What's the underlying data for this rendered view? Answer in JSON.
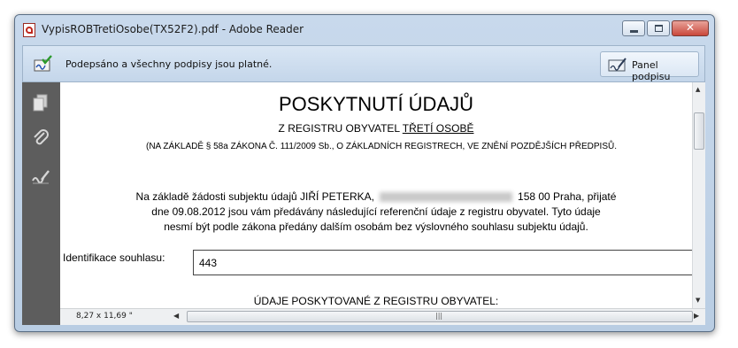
{
  "window": {
    "title": "VypisROBTretiOsobe(TX52F2).pdf - Adobe Reader"
  },
  "signature_bar": {
    "message": "Podepsáno a všechny podpisy jsou platné.",
    "panel_button_label": "Panel podpisu"
  },
  "document": {
    "heading": "POSKYTNUTÍ ÚDAJŮ",
    "subheading_prefix": "Z REGISTRU OBYVATEL ",
    "subheading_underlined": "TŘETÍ OSOBĚ",
    "legal_basis": "(NA ZÁKLADĚ § 58a ZÁKONA Č. 111/2009 Sb., O ZÁKLADNÍCH REGISTRECH, VE ZNĚNÍ POZDĚJŠÍCH PŘEDPISŮ.",
    "para_line1_a": "Na základě žádosti subjektu údajů JIŘÍ PETERKA,",
    "para_line1_b": "158 00 Praha,  přijaté",
    "para_line2": "dne 09.08.2012  jsou vám předávány následující referenční údaje z registru obyvatel. Tyto údaje",
    "para_line3": "nesmí být podle zákona předány dalším osobám bez výslovného souhlasu subjektu údajů.",
    "consent_label": "Identifikace souhlasu:",
    "consent_value": "443",
    "section_title": "ÚDAJE POSKYTOVANÉ Z REGISTRU OBYVATEL:"
  },
  "status_bar": {
    "page_size": "8,27 x 11,69 \""
  },
  "icons": {
    "app": "pdf-icon",
    "signature_valid": "signature-valid-icon",
    "panel": "signature-panel-icon",
    "left_nav": [
      "pages-icon",
      "attachment-icon",
      "signatures-icon"
    ]
  }
}
